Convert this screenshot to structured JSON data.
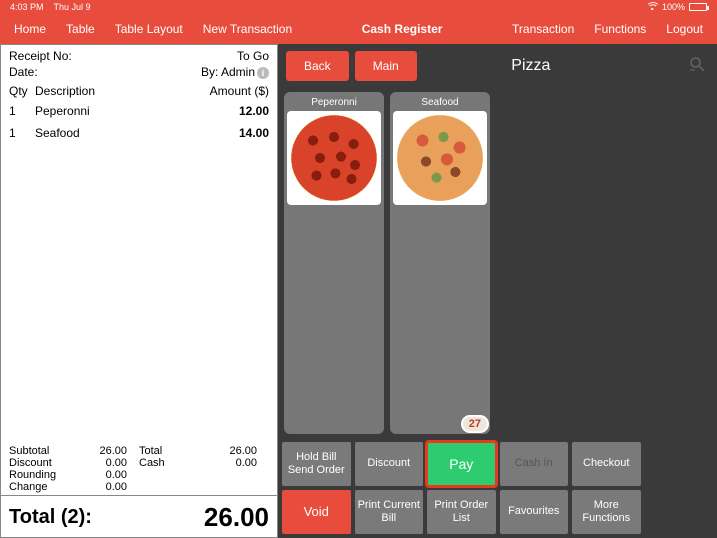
{
  "status": {
    "time": "4:03 PM",
    "date": "Thu Jul 9",
    "battery": "100%"
  },
  "nav": {
    "left": [
      "Home",
      "Table",
      "Table Layout",
      "New Transaction"
    ],
    "center": "Cash Register",
    "right": [
      "Transaction",
      "Functions",
      "Logout"
    ]
  },
  "receipt": {
    "receipt_no_label": "Receipt No:",
    "receipt_no": "",
    "status": "To Go",
    "date_label": "Date:",
    "date": "",
    "by_label": "By: Admin",
    "col_qty": "Qty",
    "col_desc": "Description",
    "col_amt": "Amount ($)",
    "items": [
      {
        "qty": "1",
        "desc": "Peperonni",
        "amt": "12.00"
      },
      {
        "qty": "1",
        "desc": "Seafood",
        "amt": "14.00"
      }
    ],
    "summary": {
      "subtotal_label": "Subtotal",
      "subtotal": "26.00",
      "total_label": "Total",
      "total": "26.00",
      "discount_label": "Discount",
      "discount": "0.00",
      "cash_label": "Cash",
      "cash": "0.00",
      "rounding_label": "Rounding",
      "rounding": "0.00",
      "change_label": "Change",
      "change": "0.00"
    },
    "total_label": "Total (2):",
    "total_value": "26.00"
  },
  "controls": {
    "back": "Back",
    "main": "Main",
    "category": "Pizza"
  },
  "products": [
    {
      "name": "Peperonni",
      "badge": ""
    },
    {
      "name": "Seafood",
      "badge": "27"
    }
  ],
  "funcs": {
    "hold": "Hold Bill Send Order",
    "discount": "Discount",
    "pay": "Pay",
    "cashin": "Cash In",
    "checkout": "Checkout",
    "void": "Void",
    "printbill": "Print Current Bill",
    "printorder": "Print Order List",
    "favourites": "Favourites",
    "more": "More Functions"
  }
}
